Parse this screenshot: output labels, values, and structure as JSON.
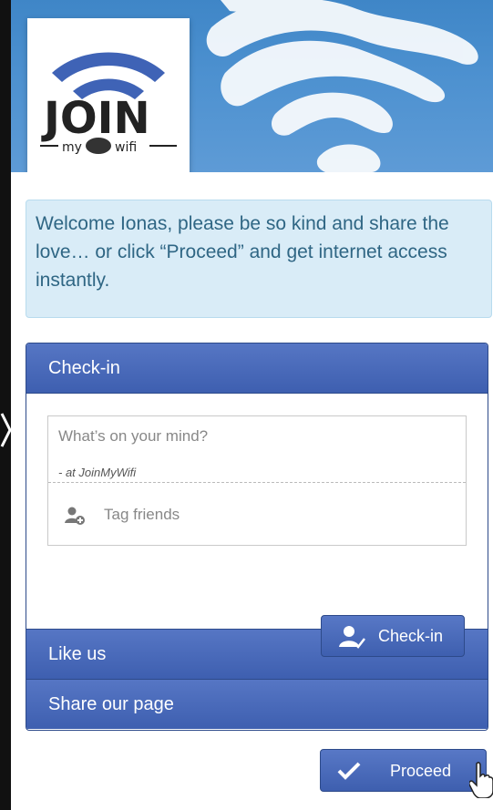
{
  "logo": {
    "word": "JOIN",
    "subtitle_left": "my",
    "subtitle_right": "wifi"
  },
  "welcome": {
    "text": "Welcome Ionas, please be so kind and share the love… or click “Proceed” and get internet access instantly."
  },
  "checkin_panel": {
    "title": "Check-in",
    "composer_placeholder": "What’s on your mind?",
    "location_text": "- at JoinMyWifi",
    "tag_friends": "Tag friends",
    "checkin_button": "Check-in"
  },
  "sections": {
    "like_us": "Like us",
    "share_page": "Share our page"
  },
  "proceed_button": "Proceed",
  "colors": {
    "accent": "#4465b8",
    "welcome_bg": "#d9ecf7",
    "welcome_text": "#2f6684"
  },
  "icons": [
    "wifi-logo-icon",
    "user-plus-icon",
    "user-check-icon",
    "checkmark-icon",
    "hand-cursor-icon",
    "chevron-left-icon"
  ]
}
